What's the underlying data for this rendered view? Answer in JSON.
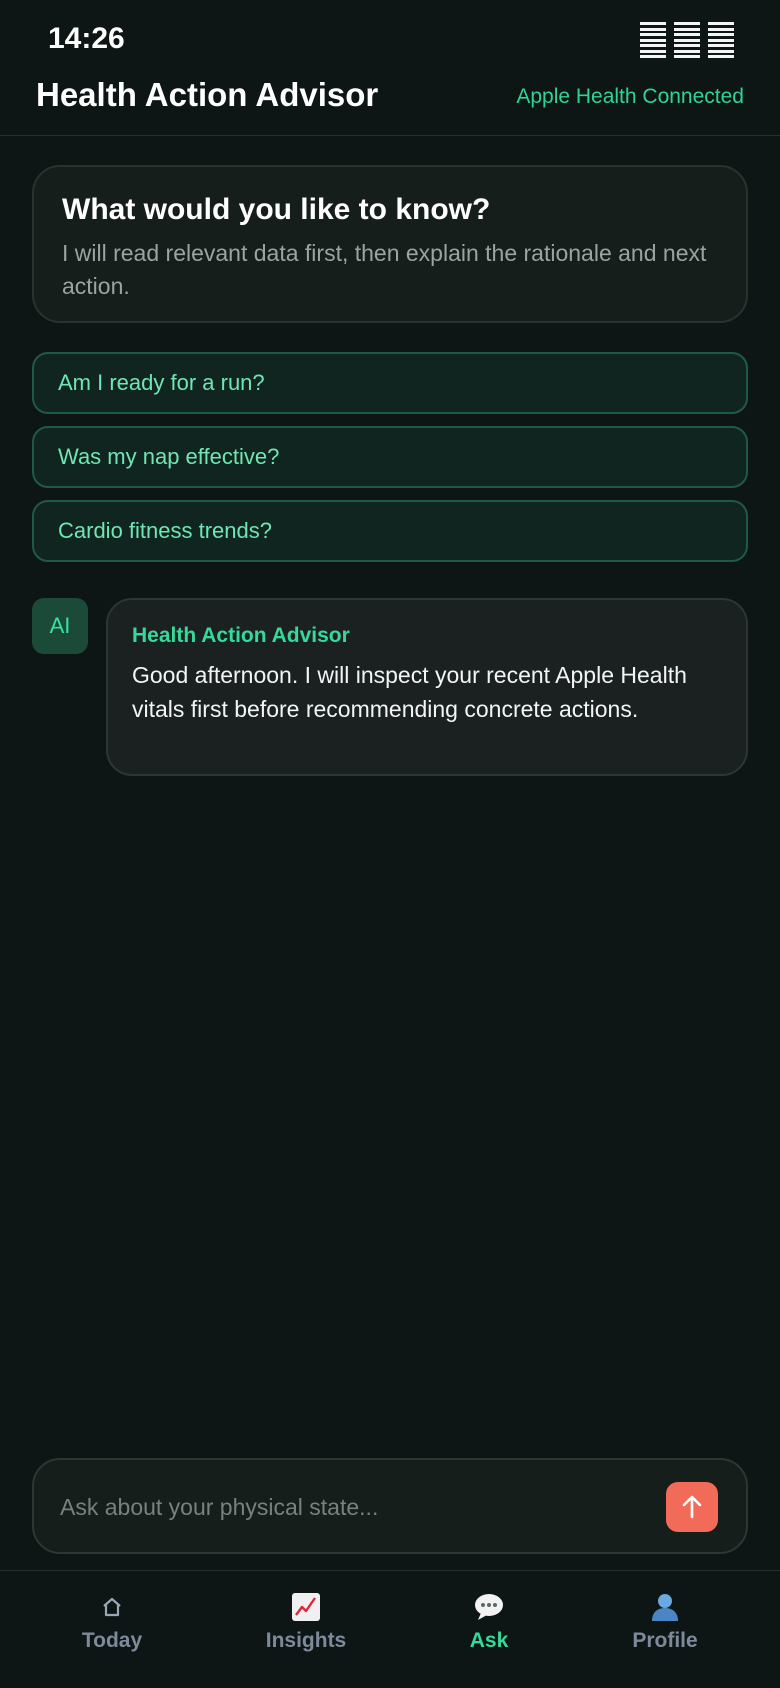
{
  "status_bar": {
    "time": "14:26"
  },
  "header": {
    "title": "Health Action Advisor",
    "connection_status": "Apple Health Connected"
  },
  "prompt_card": {
    "title": "What would you like to know?",
    "subtitle": "I will read relevant data first, then explain the rationale and next action."
  },
  "suggestions": [
    {
      "label": "Am I ready for a run?"
    },
    {
      "label": "Was my nap effective?"
    },
    {
      "label": "Cardio fitness trends?"
    }
  ],
  "messages": [
    {
      "avatar_label": "AI",
      "sender": "Health Action Advisor",
      "text": "Good afternoon. I will inspect your recent Apple Health vitals first before recommending concrete actions."
    }
  ],
  "composer": {
    "placeholder": "Ask about your physical state...",
    "send_icon": "arrow-up-icon"
  },
  "tab_bar": {
    "tabs": [
      {
        "label": "Today",
        "icon": "home-icon",
        "active": false
      },
      {
        "label": "Insights",
        "icon": "chart-icon",
        "active": false
      },
      {
        "label": "Ask",
        "icon": "speech-bubble-icon",
        "active": true
      },
      {
        "label": "Profile",
        "icon": "person-icon",
        "active": false
      }
    ]
  },
  "colors": {
    "background": "#0d1614",
    "accent": "#36d99a",
    "send_button": "#f26b59",
    "inactive_tab": "#7e8a9b"
  }
}
